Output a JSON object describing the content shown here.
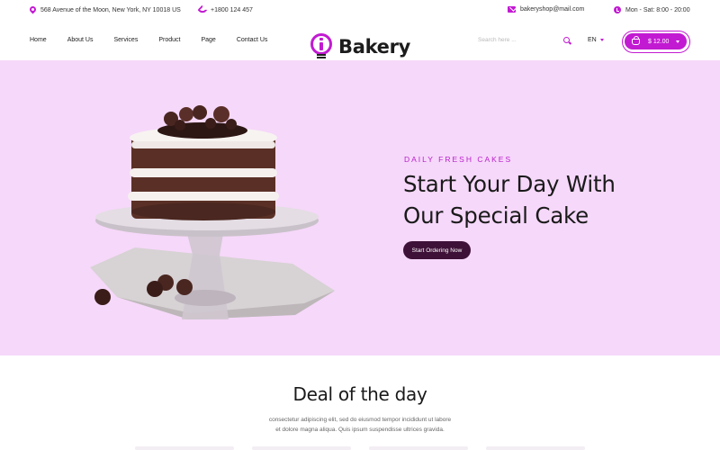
{
  "topbar": {
    "address": "568 Avenue of the Moon, New York, NY 10018 US",
    "phone": "+1800 124 457",
    "email": "bakeryshop@mail.com",
    "hours": "Mon - Sat: 8:00 - 20:00"
  },
  "nav": {
    "links": [
      "Home",
      "About Us",
      "Services",
      "Product",
      "Page",
      "Contact Us"
    ],
    "logo_text": "Bakery",
    "search_placeholder": "Search here ...",
    "language": "EN",
    "cart_total": "$ 12.00"
  },
  "hero": {
    "eyebrow": "DAILY FRESH CAKES",
    "headline_line1": "Start Your Day With",
    "headline_line2": "Our Special Cake",
    "cta_label": "Start Ordering Now"
  },
  "deal": {
    "title": "Deal of the day",
    "text_line1": "consectetur adipiscing elit, sed do eiusmod tempor incididunt ut labore",
    "text_line2": "et dolore magna aliqua. Quis ipsum suspendisse ultrices gravida."
  },
  "colors": {
    "accent": "#c21ad2",
    "hero_bg": "#f6d8fa",
    "cta_bg": "#3e1138"
  },
  "icons": {
    "address": "map-pin-icon",
    "phone": "phone-icon",
    "email": "mail-icon",
    "hours": "clock-icon",
    "search": "search-icon",
    "cart": "basket-icon"
  }
}
